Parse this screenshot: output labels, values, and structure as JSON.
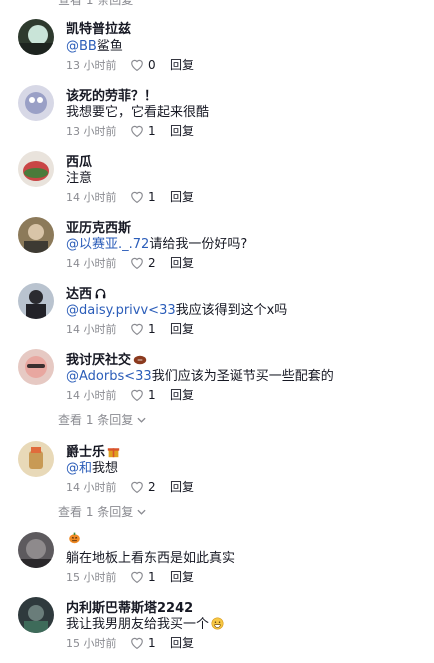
{
  "top_cut_text": "查看 1 条回复",
  "like_label": "",
  "comments": [
    {
      "name": "凯特普拉兹",
      "mention": "@BB",
      "text": "鲨鱼",
      "time": "13 小时前",
      "likes": "0",
      "reply": "回复"
    },
    {
      "name": "该死的劳菲？！",
      "mention": "",
      "text": "我想要它，它看起来很酷",
      "time": "13 小时前",
      "likes": "1",
      "reply": "回复"
    },
    {
      "name": "西瓜",
      "mention": "",
      "text": "注意",
      "time": "14 小时前",
      "likes": "1",
      "reply": "回复"
    },
    {
      "name": "亚历克西斯",
      "mention": "@以赛亚._.72",
      "text": "请给我一份好吗?",
      "time": "14 小时前",
      "likes": "2",
      "reply": "回复"
    },
    {
      "name": "达西",
      "mention": "@daisy.privv<33",
      "text": "我应该得到这个x吗",
      "time": "14 小时前",
      "likes": "1",
      "reply": "回复"
    },
    {
      "name": "我讨厌社交",
      "mention": "@Adorbs<33",
      "text": "我们应该为圣诞节买一些配套的",
      "time": "14 小时前",
      "likes": "1",
      "reply": "回复",
      "view_replies": "查看 1 条回复"
    },
    {
      "name": "爵士乐",
      "mention": "@和",
      "text": "我想",
      "time": "14 小时前",
      "likes": "2",
      "reply": "回复",
      "view_replies": "查看 1 条回复"
    },
    {
      "name": "",
      "mention": "",
      "text": "躺在地板上看东西是如此真实",
      "time": "15 小时前",
      "likes": "1",
      "reply": "回复"
    },
    {
      "name": "内利斯巴蒂斯塔2242",
      "mention": "",
      "text": "我让我男朋友给我买一个",
      "time": "15 小时前",
      "likes": "1",
      "reply": "回复"
    }
  ]
}
